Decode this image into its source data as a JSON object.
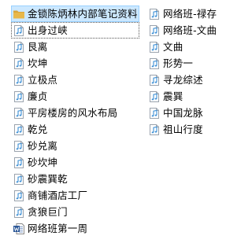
{
  "left_column": [
    {
      "label": "金锁陈炳林内部笔记资料",
      "icon": "folder-icon",
      "state": "selected"
    },
    {
      "label": "出身过峡",
      "icon": "audio-file-icon",
      "state": "focused"
    },
    {
      "label": "艮离",
      "icon": "audio-file-icon",
      "state": ""
    },
    {
      "label": "坎坤",
      "icon": "audio-file-icon",
      "state": ""
    },
    {
      "label": "立极点",
      "icon": "audio-file-icon",
      "state": ""
    },
    {
      "label": "廉贞",
      "icon": "audio-file-icon",
      "state": ""
    },
    {
      "label": "平房楼房的风水布局",
      "icon": "audio-file-icon",
      "state": ""
    },
    {
      "label": "乾兑",
      "icon": "audio-file-icon",
      "state": ""
    },
    {
      "label": "砂兑离",
      "icon": "audio-file-icon",
      "state": ""
    },
    {
      "label": "砂坎坤",
      "icon": "audio-file-icon",
      "state": ""
    },
    {
      "label": "砂震巽乾",
      "icon": "audio-file-icon",
      "state": ""
    },
    {
      "label": "商铺酒店工厂",
      "icon": "audio-file-icon",
      "state": ""
    },
    {
      "label": "贪狼巨门",
      "icon": "audio-file-icon",
      "state": ""
    },
    {
      "label": "网络班第一周",
      "icon": "word-document-icon",
      "state": ""
    }
  ],
  "right_column": [
    {
      "label": "网络班-禄存",
      "icon": "audio-file-icon",
      "state": ""
    },
    {
      "label": "网络班-文曲",
      "icon": "audio-file-icon",
      "state": ""
    },
    {
      "label": "文曲",
      "icon": "audio-file-icon",
      "state": ""
    },
    {
      "label": "形势一",
      "icon": "audio-file-icon",
      "state": ""
    },
    {
      "label": "寻龙综述",
      "icon": "audio-file-icon",
      "state": ""
    },
    {
      "label": "震巽",
      "icon": "audio-file-icon",
      "state": ""
    },
    {
      "label": "中国龙脉",
      "icon": "audio-file-icon",
      "state": ""
    },
    {
      "label": "祖山行度",
      "icon": "audio-file-icon",
      "state": ""
    }
  ],
  "colors": {
    "selected_bg": "#cce8ff",
    "selected_border": "#99d1ff",
    "audio_icon": "#3c8fd6",
    "folder_icon": "#e8b84a",
    "word_icon": "#2b5797"
  }
}
